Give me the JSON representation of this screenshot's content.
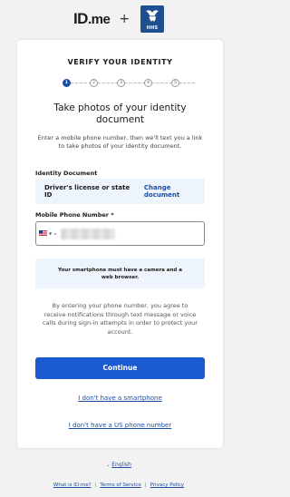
{
  "header": {
    "idme_logo": "ID.me",
    "idme_logo_main": "ID",
    "idme_logo_suffix": ".me",
    "plus": "+",
    "partner_logo": "HHS"
  },
  "card": {
    "title": "VERIFY YOUR IDENTITY",
    "steps": [
      "1",
      "2",
      "3",
      "4",
      "5"
    ],
    "active_step": 1,
    "heading": "Take photos of your identity document",
    "subtext": "Enter a mobile phone number, then we'll text you a link to take photos of your identity document.",
    "identity_document": {
      "label": "Identity Document",
      "value": "Driver's license or state ID",
      "change_link": "Change document"
    },
    "phone": {
      "label": "Mobile Phone Number *",
      "country_flag": "us-flag",
      "value_redacted": true
    },
    "notice": "Your smartphone must have a camera and a web browser.",
    "consent": "By entering your phone number, you agree to receive notifications through text message or voice calls during sign-in attempts in order to protect your account.",
    "continue_button": "Continue",
    "no_smartphone_link": "I don't have a smartphone",
    "no_us_phone_link": "I don't have a US phone number"
  },
  "footer": {
    "language": "English",
    "links": [
      "What is ID.me?",
      "Terms of Service",
      "Privacy Policy"
    ],
    "separator": "|"
  },
  "colors": {
    "page_bg": "#f2f2f2",
    "card_bg": "#ffffff",
    "primary": "#1b5bd1",
    "link": "#1b4ea3",
    "info_bg": "#eef4fb",
    "hhs_blue": "#1f4f8f"
  }
}
